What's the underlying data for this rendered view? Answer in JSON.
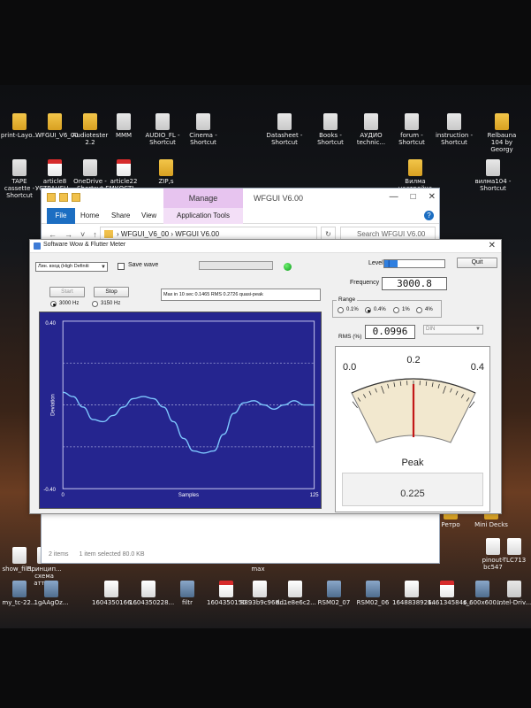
{
  "desktop": {
    "icons_row1": [
      {
        "label": "print-Layo...",
        "kind": "folder"
      },
      {
        "label": "WFGUI_V6_00",
        "kind": "folder"
      },
      {
        "label": "Audiotester 2.2",
        "kind": "folder"
      },
      {
        "label": "MMM",
        "kind": "exe"
      },
      {
        "label": "AUDIO_FL - Shortcut",
        "kind": "exe"
      },
      {
        "label": "Cinema - Shortcut",
        "kind": "exe"
      },
      {
        "label": "Datasheet - Shortcut",
        "kind": "exe"
      },
      {
        "label": "Books - Shortcut",
        "kind": "exe"
      },
      {
        "label": "АУДИО technic...",
        "kind": "exe"
      },
      {
        "label": "forum - Shortcut",
        "kind": "exe"
      },
      {
        "label": "instruction - Shortcut",
        "kind": "exe"
      },
      {
        "label": "Relbauna 104 by Georgy",
        "kind": "folder"
      }
    ],
    "icons_row2": [
      {
        "label": "TAPE cassette - Shortcut",
        "kind": "exe"
      },
      {
        "label": "article8 УСТРАНЕН...",
        "kind": "pdf"
      },
      {
        "label": "OneDrive - Shortcut",
        "kind": "exe"
      },
      {
        "label": "article22 ЕМКОСТЬ...",
        "kind": "pdf"
      },
      {
        "label": "ZIP,s",
        "kind": "folder"
      },
      {
        "label": "Вилма настройка",
        "kind": "folder"
      },
      {
        "label": "вилма104 - Shortcut",
        "kind": "exe"
      }
    ],
    "icons_right": [
      {
        "label": "Ретро",
        "kind": "folder"
      },
      {
        "label": "Mini Decks",
        "kind": "folder"
      },
      {
        "label": "pinout-bc547",
        "kind": "doc"
      },
      {
        "label": "TLC713",
        "kind": "doc"
      }
    ],
    "icons_row3": [
      {
        "label": "show_file...",
        "kind": "doc"
      },
      {
        "label": "Принцип... схема атте...",
        "kind": "doc"
      },
      {
        "label": "max",
        "kind": "doc"
      }
    ],
    "icons_row4": [
      {
        "label": "my_tc-22...",
        "kind": "img"
      },
      {
        "label": "1gAAgOz...",
        "kind": "img"
      },
      {
        "label": "1604350166...",
        "kind": "doc"
      },
      {
        "label": "1604350228...",
        "kind": "doc"
      },
      {
        "label": "filtr",
        "kind": "img"
      },
      {
        "label": "1604350150...",
        "kind": "pdf"
      },
      {
        "label": "8893b9c968...",
        "kind": "doc"
      },
      {
        "label": "dd1e8e6c2...",
        "kind": "doc"
      },
      {
        "label": "RSM02_07",
        "kind": "img"
      },
      {
        "label": "RSM02_06",
        "kind": "img"
      },
      {
        "label": "1648838926...",
        "kind": "doc"
      },
      {
        "label": "1461345846...",
        "kind": "pdf"
      },
      {
        "label": "s_600x600...",
        "kind": "img"
      },
      {
        "label": "Intel-Driv...",
        "kind": "exe"
      }
    ]
  },
  "explorer": {
    "manage_label": "Manage",
    "title": "WFGUI V6.00",
    "tabs": {
      "file": "File",
      "home": "Home",
      "share": "Share",
      "view": "View",
      "app_tools": "Application Tools"
    },
    "path_parent": "WFGUI_V6_00",
    "path_current": "WFGUI V6.00",
    "search_placeholder": "Search WFGUI V6.00",
    "status_items": "2 items",
    "status_selected": "1 item selected  80.0 KB"
  },
  "meter": {
    "title": "Software Wow & Flutter Meter",
    "input_select": "Лин. вход (High Definiti",
    "save_wave_label": "Save wave",
    "level_label": "Level",
    "level_fraction": 0.22,
    "quit_label": "Quit",
    "start_label": "Start",
    "stop_label": "Stop",
    "info_text": "Max in 10 sec 0.1465 RMS 0.2726 quasi-peak",
    "freq_3000_label": "3000 Hz",
    "freq_3150_label": "3150 Hz",
    "frequency_label": "Frequency",
    "frequency_value": "3000.8",
    "range_title": "Range",
    "range_options": [
      "0.1%",
      "0.4%",
      "1%",
      "4%"
    ],
    "range_selected": 1,
    "rms_label": "RMS (%)",
    "rms_value": "0.0996",
    "weighting_value": "DIN",
    "gauge": {
      "scale_min": "0.0",
      "scale_mid": "0.2",
      "scale_max": "0.4",
      "needle_value": 0.2,
      "mode_label": "Peak",
      "peak_value": "0.225"
    }
  },
  "chart_data": {
    "type": "line",
    "title": "",
    "xlabel": "Samples",
    "ylabel": "Deviation",
    "xlim": [
      0,
      125
    ],
    "ylim": [
      -0.4,
      0.4
    ],
    "x_tick_labels": [
      "0",
      "125"
    ],
    "y_tick_labels": [
      "0.40",
      "-0.40"
    ],
    "grid": "dotted horizontal",
    "colors": {
      "background": "#25258f",
      "line": "#7ec8ff",
      "grid": "#9da0d8"
    },
    "series": [
      {
        "x": [
          0,
          5,
          10,
          15,
          20,
          25,
          30,
          35,
          40,
          45,
          50,
          55,
          60,
          65,
          70,
          75,
          80,
          85,
          90,
          95,
          100,
          105,
          110,
          115,
          120,
          125
        ],
        "values": [
          0.06,
          0.04,
          -0.01,
          -0.07,
          -0.08,
          -0.05,
          -0.01,
          0.03,
          0.04,
          0.03,
          -0.01,
          -0.08,
          -0.16,
          -0.22,
          -0.23,
          -0.22,
          -0.14,
          -0.04,
          0.01,
          0.02,
          0.0,
          -0.02,
          0.0,
          0.02,
          0.0,
          0.0
        ]
      }
    ]
  }
}
